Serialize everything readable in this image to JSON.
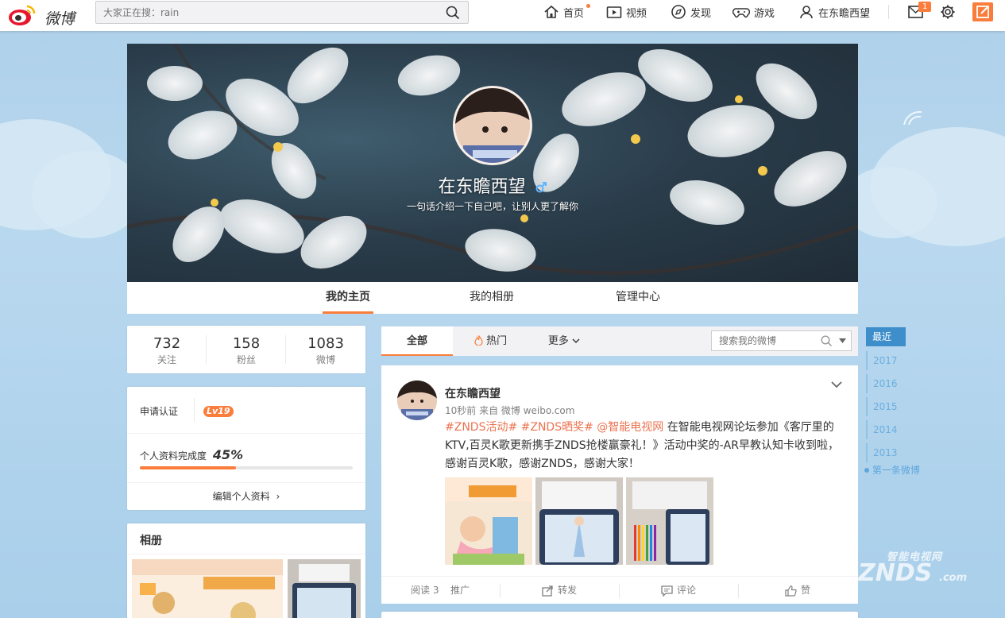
{
  "topbar": {
    "logo_text": "微博",
    "search_placeholder": "大家正在搜：rain",
    "nav": [
      {
        "label": "首页"
      },
      {
        "label": "视频"
      },
      {
        "label": "发现"
      },
      {
        "label": "游戏"
      },
      {
        "label": "在东瞻西望"
      }
    ],
    "message_badge": "1",
    "accent_color": "#fa7d3c"
  },
  "profile": {
    "name": "在东瞻西望",
    "bio": "一句话介绍一下自己吧，让别人更了解你",
    "tabs": [
      "我的主页",
      "我的相册",
      "管理中心"
    ],
    "active_tab": "我的主页"
  },
  "stats": {
    "following": {
      "value": "732",
      "label": "关注"
    },
    "followers": {
      "value": "158",
      "label": "粉丝"
    },
    "weibo": {
      "value": "1083",
      "label": "微博"
    }
  },
  "account": {
    "verify_label": "申请认证",
    "level": "Lv19",
    "completion_label": "个人资料完成度",
    "completion_value": "45%",
    "completion_fraction": 0.45,
    "edit_label": "编辑个人资料"
  },
  "album": {
    "title": "相册"
  },
  "feed": {
    "tabs": [
      "全部",
      "热门",
      "更多"
    ],
    "search_placeholder": "搜索我的微博",
    "post": {
      "author": "在东瞻西望",
      "meta": "10秒前 来自 微博 weibo.com",
      "tags": "#ZNDS活动# #ZNDS晒奖# @智能电视网",
      "text": " 在智能电视网论坛参加《客厅里的KTV,百灵K歌更新携手ZNDS抢楼赢豪礼！》活动中奖的-AR早教认知卡收到啦，感谢百灵K歌，感谢ZNDS，感谢大家！",
      "reads": "阅读 3",
      "promote": "推广",
      "repost": "转发",
      "comment": "评论",
      "like": "赞"
    }
  },
  "timeline": {
    "active": "最近",
    "years": [
      "2017",
      "2016",
      "2015",
      "2014",
      "2013"
    ],
    "first": "第一条微博"
  },
  "watermark": {
    "cn": "智能电视网",
    "en": "ZNDS",
    "suffix": ".com"
  }
}
